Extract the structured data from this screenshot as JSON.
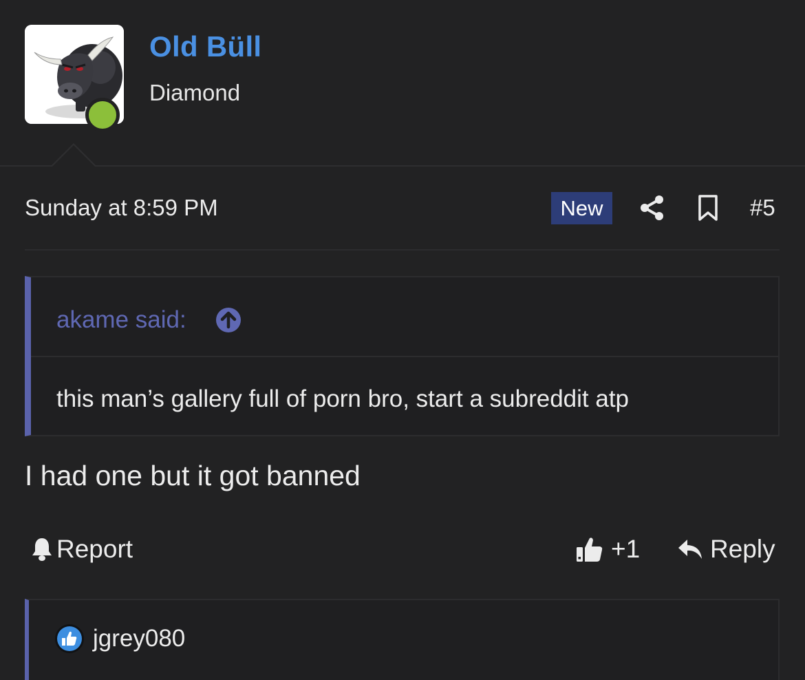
{
  "user": {
    "name": "Old Büll",
    "title": "Diamond",
    "status_color": "#8cbf3a",
    "name_color": "#4a90e2",
    "avatar_icon": "bull-avatar"
  },
  "post": {
    "date": "Sunday at 8:59 PM",
    "new_badge": "New",
    "number": "#5",
    "badge_color": "#2d3d78"
  },
  "quote": {
    "author_line": "akame said:",
    "text": "this man’s gallery full of porn bro, start a subreddit atp",
    "accent_color": "#5a62ab"
  },
  "message": {
    "text": "I had one but it got banned"
  },
  "actions": {
    "report_label": "Report",
    "like_label": "+1",
    "reply_label": "Reply"
  },
  "reactions": {
    "user": "jgrey080",
    "reaction_icon": "like-reaction-icon"
  }
}
